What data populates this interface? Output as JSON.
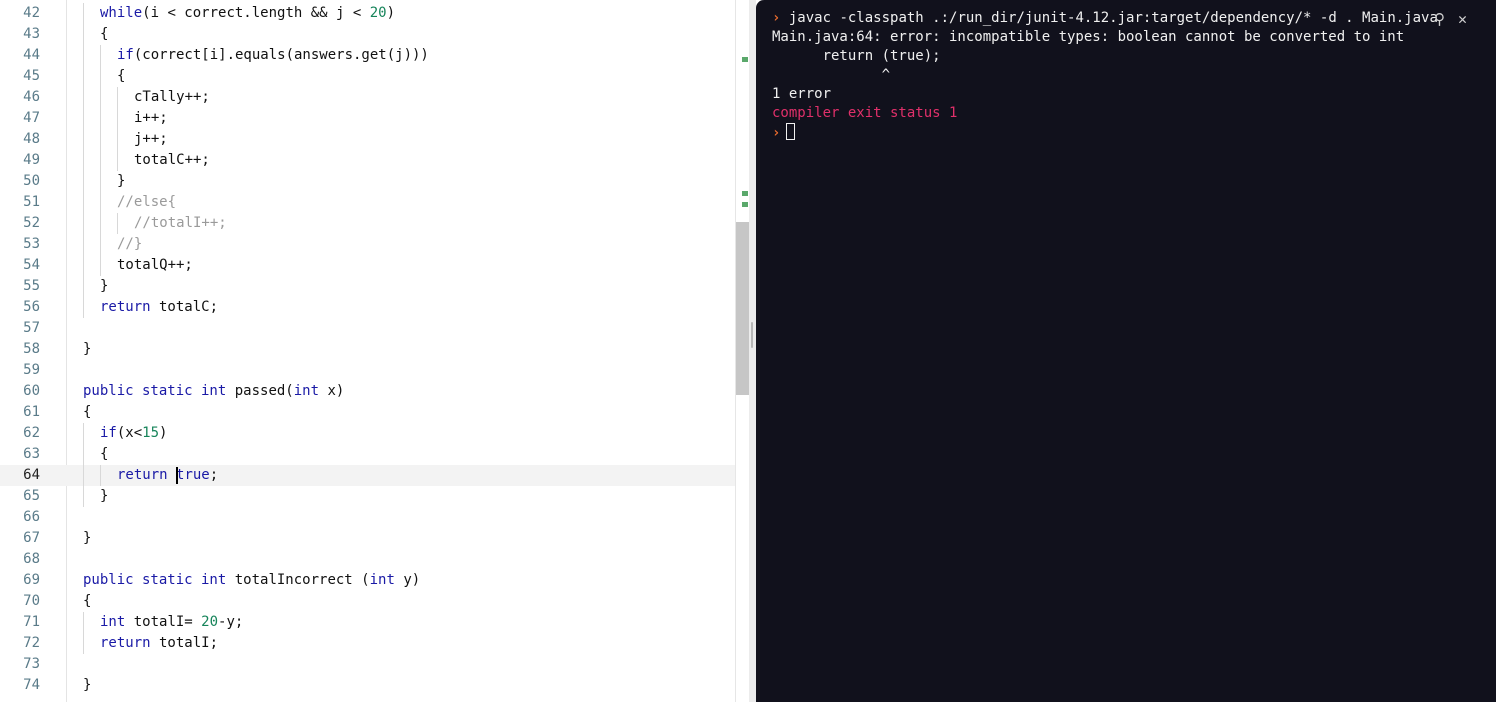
{
  "editor": {
    "active_line": 64,
    "lines": [
      {
        "n": "42",
        "indent": 1,
        "tokens": [
          [
            "kw",
            "while"
          ],
          [
            "",
            "(i < correct.length && j < "
          ],
          [
            "num",
            "20"
          ],
          [
            "",
            ")"
          ]
        ]
      },
      {
        "n": "43",
        "indent": 1,
        "tokens": [
          [
            "",
            "{"
          ]
        ]
      },
      {
        "n": "44",
        "indent": 2,
        "tokens": [
          [
            "kw",
            "if"
          ],
          [
            "",
            "(correct[i].equals(answers.get(j)))"
          ]
        ]
      },
      {
        "n": "45",
        "indent": 2,
        "tokens": [
          [
            "",
            "{"
          ]
        ]
      },
      {
        "n": "46",
        "indent": 3,
        "tokens": [
          [
            "",
            "cTally++;"
          ]
        ]
      },
      {
        "n": "47",
        "indent": 3,
        "tokens": [
          [
            "",
            "i++;"
          ]
        ]
      },
      {
        "n": "48",
        "indent": 3,
        "tokens": [
          [
            "",
            "j++;"
          ]
        ]
      },
      {
        "n": "49",
        "indent": 3,
        "tokens": [
          [
            "",
            "totalC++;"
          ]
        ]
      },
      {
        "n": "50",
        "indent": 2,
        "tokens": [
          [
            "",
            "}"
          ]
        ]
      },
      {
        "n": "51",
        "indent": 2,
        "tokens": [
          [
            "cm",
            "//else{"
          ]
        ]
      },
      {
        "n": "52",
        "indent": 3,
        "tokens": [
          [
            "cm",
            "//totalI++;"
          ]
        ]
      },
      {
        "n": "53",
        "indent": 2,
        "tokens": [
          [
            "cm",
            "//}"
          ]
        ]
      },
      {
        "n": "54",
        "indent": 2,
        "tokens": [
          [
            "",
            "totalQ++;"
          ]
        ]
      },
      {
        "n": "55",
        "indent": 1,
        "tokens": [
          [
            "",
            "}"
          ]
        ]
      },
      {
        "n": "56",
        "indent": 1,
        "tokens": [
          [
            "kw",
            "return"
          ],
          [
            "",
            " totalC;"
          ]
        ]
      },
      {
        "n": "57",
        "indent": 0,
        "tokens": []
      },
      {
        "n": "58",
        "indent": 0,
        "tokens": [
          [
            "",
            "}"
          ]
        ]
      },
      {
        "n": "59",
        "indent": 0,
        "tokens": []
      },
      {
        "n": "60",
        "indent": 0,
        "tokens": [
          [
            "kw",
            "public static int"
          ],
          [
            "",
            " passed("
          ],
          [
            "kw",
            "int"
          ],
          [
            "",
            " x)"
          ]
        ]
      },
      {
        "n": "61",
        "indent": 0,
        "tokens": [
          [
            "",
            "{"
          ]
        ]
      },
      {
        "n": "62",
        "indent": 1,
        "tokens": [
          [
            "kw",
            "if"
          ],
          [
            "",
            "(x<"
          ],
          [
            "num",
            "15"
          ],
          [
            "",
            ")"
          ]
        ]
      },
      {
        "n": "63",
        "indent": 1,
        "tokens": [
          [
            "",
            "{"
          ]
        ]
      },
      {
        "n": "64",
        "indent": 2,
        "tokens": [
          [
            "kw",
            "return"
          ],
          [
            "",
            " "
          ],
          [
            "kw",
            "true"
          ],
          [
            "",
            ";"
          ]
        ]
      },
      {
        "n": "65",
        "indent": 1,
        "tokens": [
          [
            "",
            "}"
          ]
        ]
      },
      {
        "n": "66",
        "indent": 0,
        "tokens": []
      },
      {
        "n": "67",
        "indent": 0,
        "tokens": [
          [
            "",
            "}"
          ]
        ]
      },
      {
        "n": "68",
        "indent": 0,
        "tokens": []
      },
      {
        "n": "69",
        "indent": 0,
        "tokens": [
          [
            "kw",
            "public static int"
          ],
          [
            "",
            " totalIncorrect ("
          ],
          [
            "kw",
            "int"
          ],
          [
            "",
            " y)"
          ]
        ]
      },
      {
        "n": "70",
        "indent": 0,
        "tokens": [
          [
            "",
            "{"
          ]
        ]
      },
      {
        "n": "71",
        "indent": 1,
        "tokens": [
          [
            "kw",
            "int"
          ],
          [
            "",
            " totalI= "
          ],
          [
            "num",
            "20"
          ],
          [
            "",
            "-y;"
          ]
        ]
      },
      {
        "n": "72",
        "indent": 1,
        "tokens": [
          [
            "kw",
            "return"
          ],
          [
            "",
            " totalI;"
          ]
        ]
      },
      {
        "n": "73",
        "indent": 0,
        "tokens": []
      },
      {
        "n": "74",
        "indent": 0,
        "tokens": [
          [
            "",
            "}"
          ]
        ]
      }
    ]
  },
  "terminal": {
    "prompt_symbol": "›",
    "command": "javac -classpath .:/run_dir/junit-4.12.jar:target/dependency/* -d . Main.java",
    "output": [
      "Main.java:64: error: incompatible types: boolean cannot be converted to int",
      "      return (true);",
      "             ^",
      "1 error"
    ],
    "exit_message": "compiler exit status 1",
    "search_icon": "⚲",
    "close_icon": "✕"
  },
  "colors": {
    "terminal_bg": "#11111c",
    "prompt": "#e66b2e",
    "error": "#e0306a",
    "keyword": "#1a1aa6",
    "number": "#16845a"
  }
}
